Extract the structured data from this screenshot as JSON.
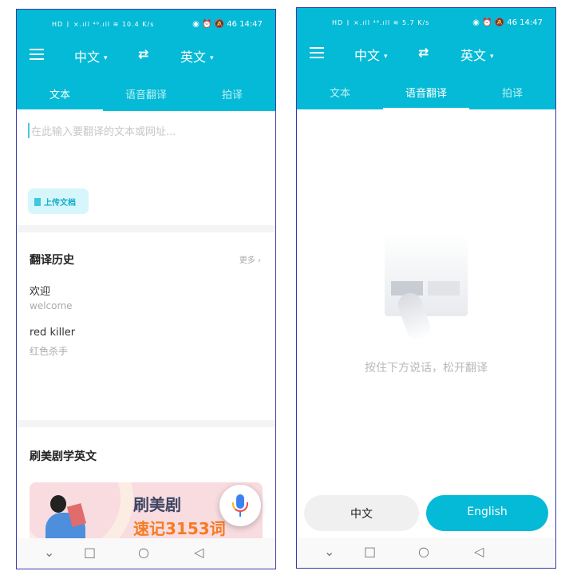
{
  "colors": {
    "accent": "#04bad6",
    "banner_orange": "#f57b22"
  },
  "status_bar": {
    "left_icons": "HD ᛒ ×.ıll ⁴⁶.ıll ≋",
    "speed_left": "10.4 K/s",
    "speed_right": "5.7 K/s",
    "right_icons": "◉ ⏰ 🔕 46",
    "time": "14:47"
  },
  "toolbar": {
    "menu_icon": "hamburger-icon",
    "source_lang": "中文",
    "target_lang": "英文",
    "dropdown_glyph": "▾",
    "swap_glyph": "⇄"
  },
  "tabs": [
    "文本",
    "语音翻译",
    "拍译"
  ],
  "text_tab": {
    "input_placeholder": "在此输入要翻译的文本或网址...",
    "upload_label": "上传文档",
    "history": {
      "title": "翻译历史",
      "more": "更多 ›",
      "items": [
        {
          "source": "欢迎",
          "target": "welcome"
        },
        {
          "source": "red killer",
          "target": "红色杀手"
        }
      ]
    },
    "promo": {
      "title": "刷美剧学英文",
      "banner_line1": "刷美剧",
      "banner_line2": "速记3153词"
    }
  },
  "voice_tab": {
    "hint": "按住下方说话，松开翻译",
    "button_source": "中文",
    "button_target": "English"
  },
  "nav_bar": {
    "collapse": "⌄",
    "recents": "□",
    "home": "○",
    "back": "◁"
  }
}
